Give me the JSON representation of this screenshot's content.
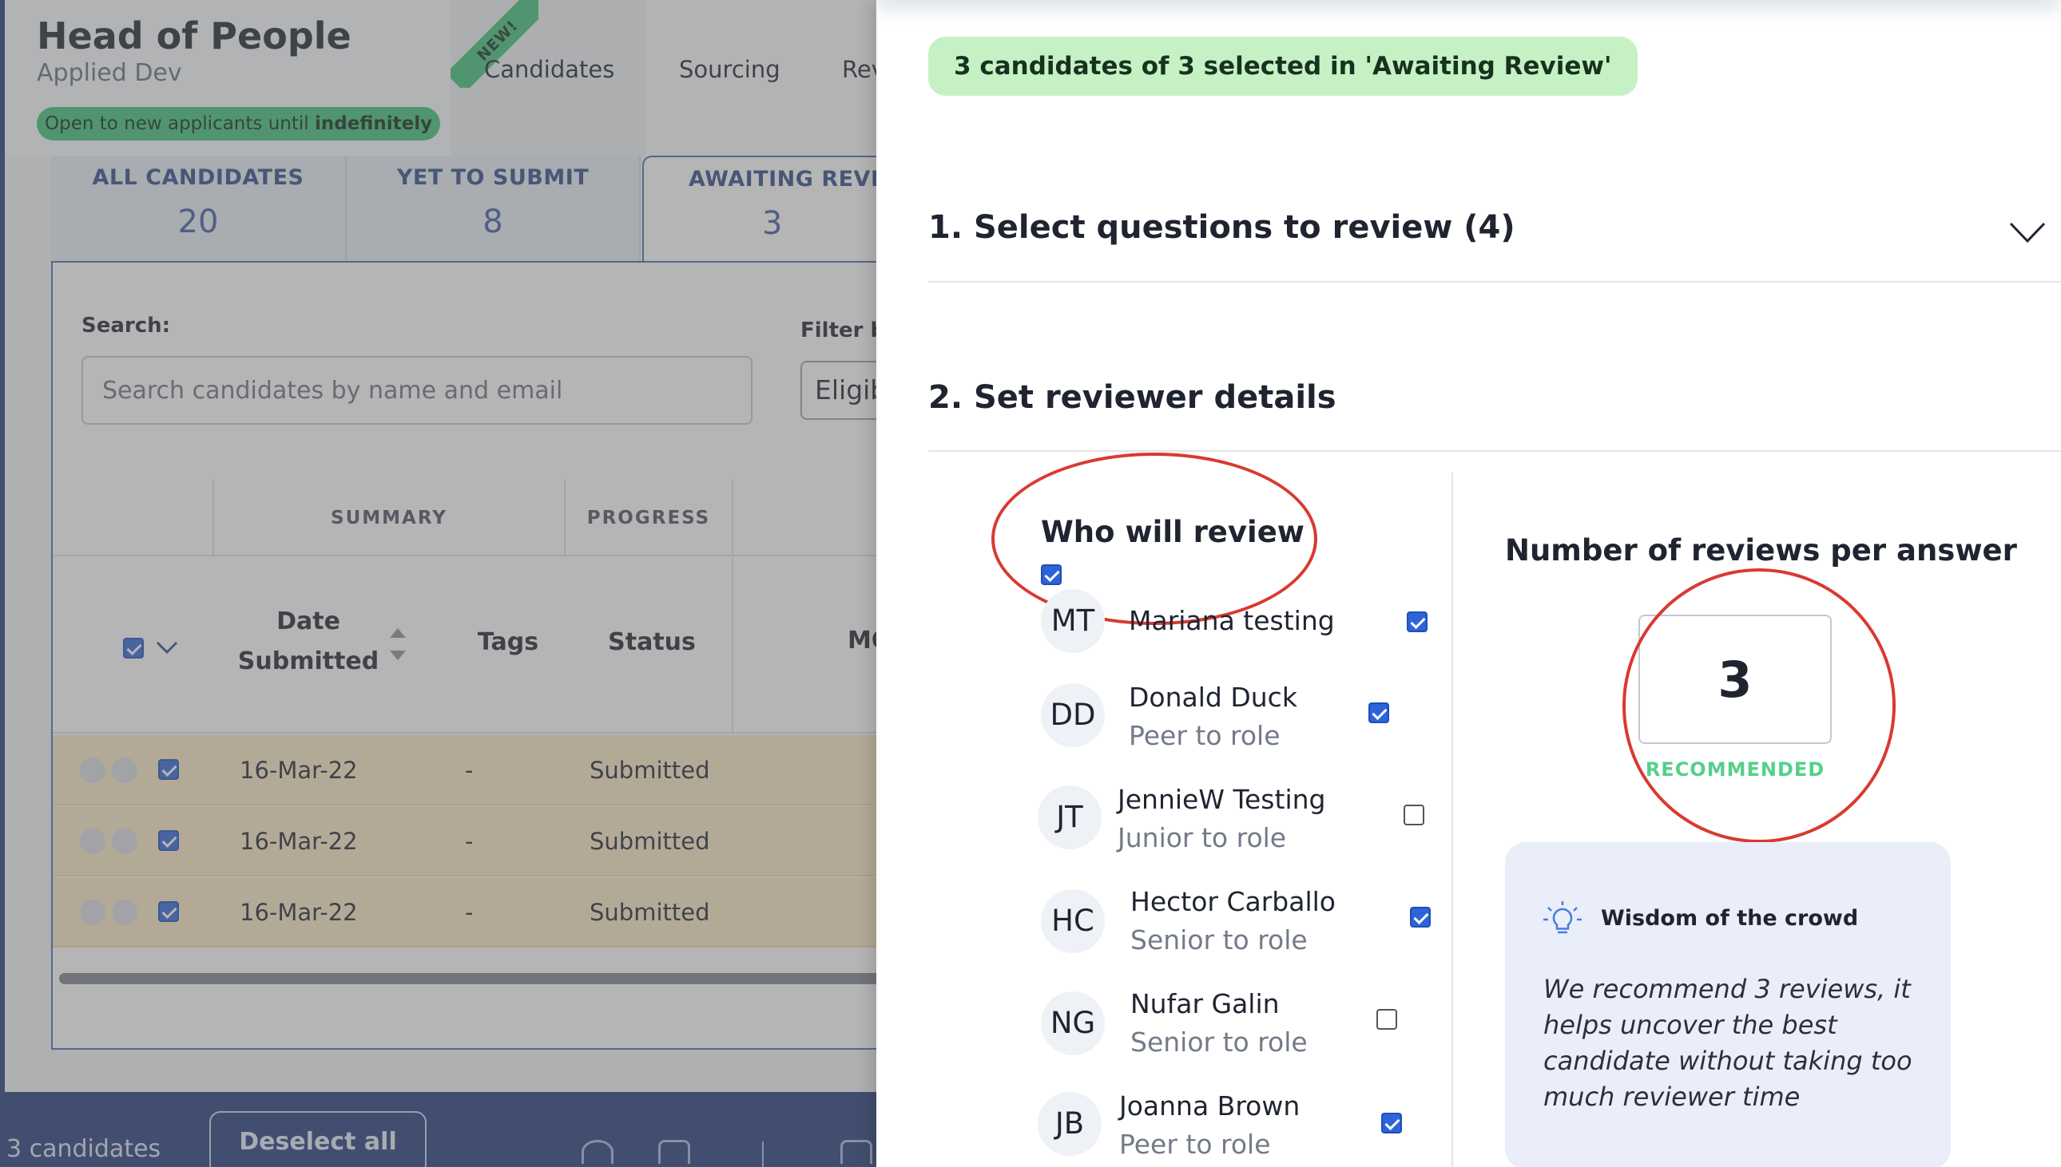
{
  "job": {
    "title": "Head of People",
    "org": "Applied Dev",
    "open_prefix": "Open to new applicants until ",
    "open_until": "indefinitely"
  },
  "top_tabs": {
    "badge": "NEW!",
    "candidates": "Candidates",
    "sourcing": "Sourcing",
    "review": "Rev"
  },
  "counts": [
    {
      "label": "ALL CANDIDATES",
      "value": "20"
    },
    {
      "label": "YET TO SUBMIT",
      "value": "8"
    },
    {
      "label": "AWAITING REVIEW",
      "value": "3"
    }
  ],
  "search": {
    "label": "Search:",
    "placeholder": "Search candidates by name and email",
    "filter_label": "Filter by",
    "filter_value": "Eligib"
  },
  "table": {
    "group_headers": [
      "SUMMARY",
      "PROGRESS"
    ],
    "columns": {
      "date_line1": "Date",
      "date_line2": "Submitted",
      "tags": "Tags",
      "status": "Status",
      "more": "MO"
    },
    "rows": [
      {
        "date": "16-Mar-22",
        "tags": "-",
        "status": "Submitted"
      },
      {
        "date": "16-Mar-22",
        "tags": "-",
        "status": "Submitted"
      },
      {
        "date": "16-Mar-22",
        "tags": "-",
        "status": "Submitted"
      }
    ]
  },
  "bottom_bar": {
    "count": "3 candidates",
    "deselect": "Deselect all"
  },
  "modal": {
    "selection_pill": "3 candidates of 3 selected in 'Awaiting Review'",
    "section1": "1. Select questions to review (4)",
    "section2": "2. Set reviewer details",
    "who_title": "Who will review",
    "reviewers": [
      {
        "initials": "MT",
        "name": "Mariana testing",
        "role": "",
        "checked": true
      },
      {
        "initials": "DD",
        "name": "Donald Duck",
        "role": "Peer to role",
        "checked": true
      },
      {
        "initials": "JT",
        "name": "JennieW Testing",
        "role": "Junior to role",
        "checked": false
      },
      {
        "initials": "HC",
        "name": "Hector Carballo",
        "role": "Senior to role",
        "checked": true
      },
      {
        "initials": "NG",
        "name": "Nufar Galin",
        "role": "Senior to role",
        "checked": false
      },
      {
        "initials": "JB",
        "name": "Joanna Brown",
        "role": "Peer to role",
        "checked": true
      }
    ],
    "num_title": "Number of reviews per answer",
    "num_value": "3",
    "recommended": "RECOMMENDED",
    "wisdom_title": "Wisdom of the crowd",
    "wisdom_body": "We recommend 3 reviews, it helps uncover the best candidate without taking too much reviewer time"
  },
  "colors": {
    "accent_blue": "#2e64d9",
    "annotation_red": "#d93a30",
    "pill_green": "#c6f1c4",
    "recommended_green": "#55d089",
    "row_highlight": "#fbe9c6"
  }
}
